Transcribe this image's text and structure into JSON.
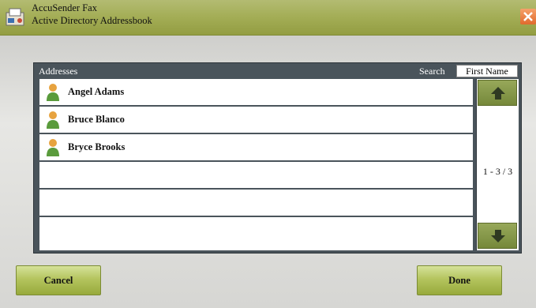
{
  "window": {
    "app_name": "AccuSender Fax",
    "title": "Active Directory Addressbook",
    "close_icon": "close-icon"
  },
  "panel": {
    "header_label": "Addresses",
    "search_label": "Search",
    "search_field": "First Name"
  },
  "contacts": [
    {
      "name": "Angel Adams",
      "icon": "person-icon"
    },
    {
      "name": "Bruce Blanco",
      "icon": "person-icon"
    },
    {
      "name": "Bryce Brooks",
      "icon": "person-icon"
    }
  ],
  "pagination": {
    "indicator": "1 - 3 / 3",
    "up_icon": "arrow-up-icon",
    "down_icon": "arrow-down-icon"
  },
  "buttons": {
    "cancel": "Cancel",
    "done": "Done"
  },
  "colors": {
    "title_bar": "#a3ad55",
    "panel": "#4a545b",
    "button_green": "#b4c45e",
    "close": "#e06a2d"
  }
}
